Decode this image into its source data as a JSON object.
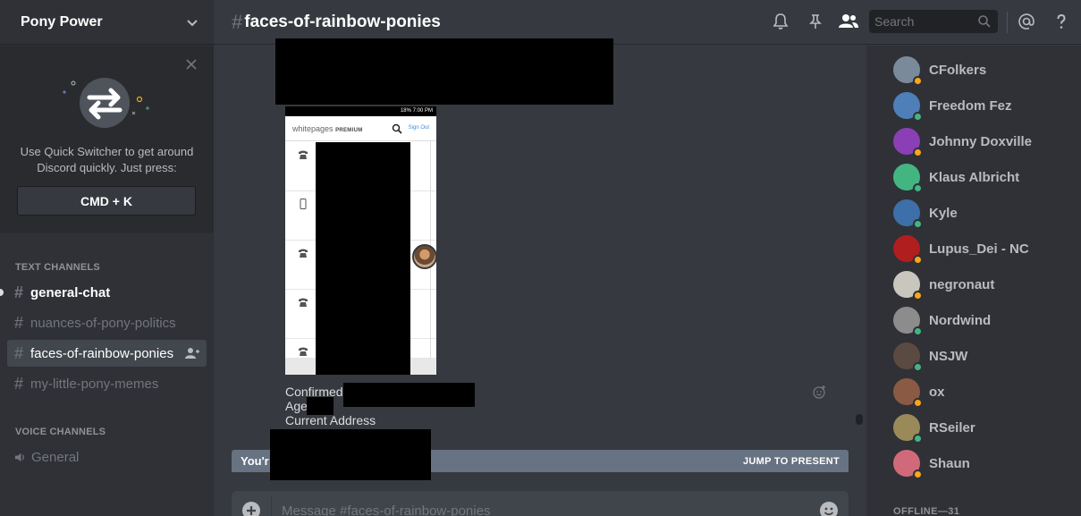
{
  "guild": {
    "name": "Pony Power"
  },
  "quick_switcher": {
    "text": "Use Quick Switcher to get around Discord quickly. Just press:",
    "shortcut": "CMD + K"
  },
  "channels": {
    "text_header": "TEXT CHANNELS",
    "text": [
      {
        "name": "general-chat",
        "state": "unread"
      },
      {
        "name": "nuances-of-pony-politics",
        "state": "normal"
      },
      {
        "name": "faces-of-rainbow-ponies",
        "state": "active"
      },
      {
        "name": "my-little-pony-memes",
        "state": "normal"
      }
    ],
    "voice_header": "VOICE CHANNELS",
    "voice": [
      {
        "name": "General"
      }
    ]
  },
  "header": {
    "channel": "faces-of-rainbow-ponies",
    "search_placeholder": "Search",
    "icons": [
      "bell-icon",
      "pin-icon",
      "members-icon",
      "search-icon",
      "mention-icon",
      "help-icon"
    ]
  },
  "message": {
    "phone": {
      "status": "18% 7:00 PM",
      "brand": "whitepages",
      "brand_suffix": "PREMIUM",
      "signout": "Sign Out"
    },
    "lines": {
      "confirmed": "Confirmed",
      "age": "Age",
      "address": "Current Address"
    }
  },
  "new_messages": {
    "text": "You'r",
    "jump": "JUMP TO PRESENT"
  },
  "composer": {
    "placeholder": "Message #faces-of-rainbow-ponies"
  },
  "members": {
    "online": [
      {
        "name": "CFolkers",
        "status": "idle",
        "color": "#7a8a9a"
      },
      {
        "name": "Freedom Fez",
        "status": "online",
        "color": "#4f7fb8"
      },
      {
        "name": "Johnny Doxville",
        "status": "idle",
        "color": "#8a3fb5"
      },
      {
        "name": "Klaus Albricht",
        "status": "online",
        "color": "#43b581"
      },
      {
        "name": "Kyle",
        "status": "online",
        "color": "#3d6fa8"
      },
      {
        "name": "Lupus_Dei - NC",
        "status": "idle",
        "color": "#b01e1e"
      },
      {
        "name": "negronaut",
        "status": "idle",
        "color": "#c9c6bd"
      },
      {
        "name": "Nordwind",
        "status": "online",
        "color": "#8c8c8c"
      },
      {
        "name": "NSJW",
        "status": "online",
        "color": "#5a4a42"
      },
      {
        "name": "ox",
        "status": "idle",
        "color": "#8a5a44"
      },
      {
        "name": "RSeiler",
        "status": "online",
        "color": "#9a8a5a"
      },
      {
        "name": "Shaun",
        "status": "idle",
        "color": "#d06a7a"
      }
    ],
    "offline_header": "OFFLINE—31"
  },
  "colors": {
    "online": "#43b581",
    "idle": "#faa61a",
    "accent": "#7289da"
  }
}
